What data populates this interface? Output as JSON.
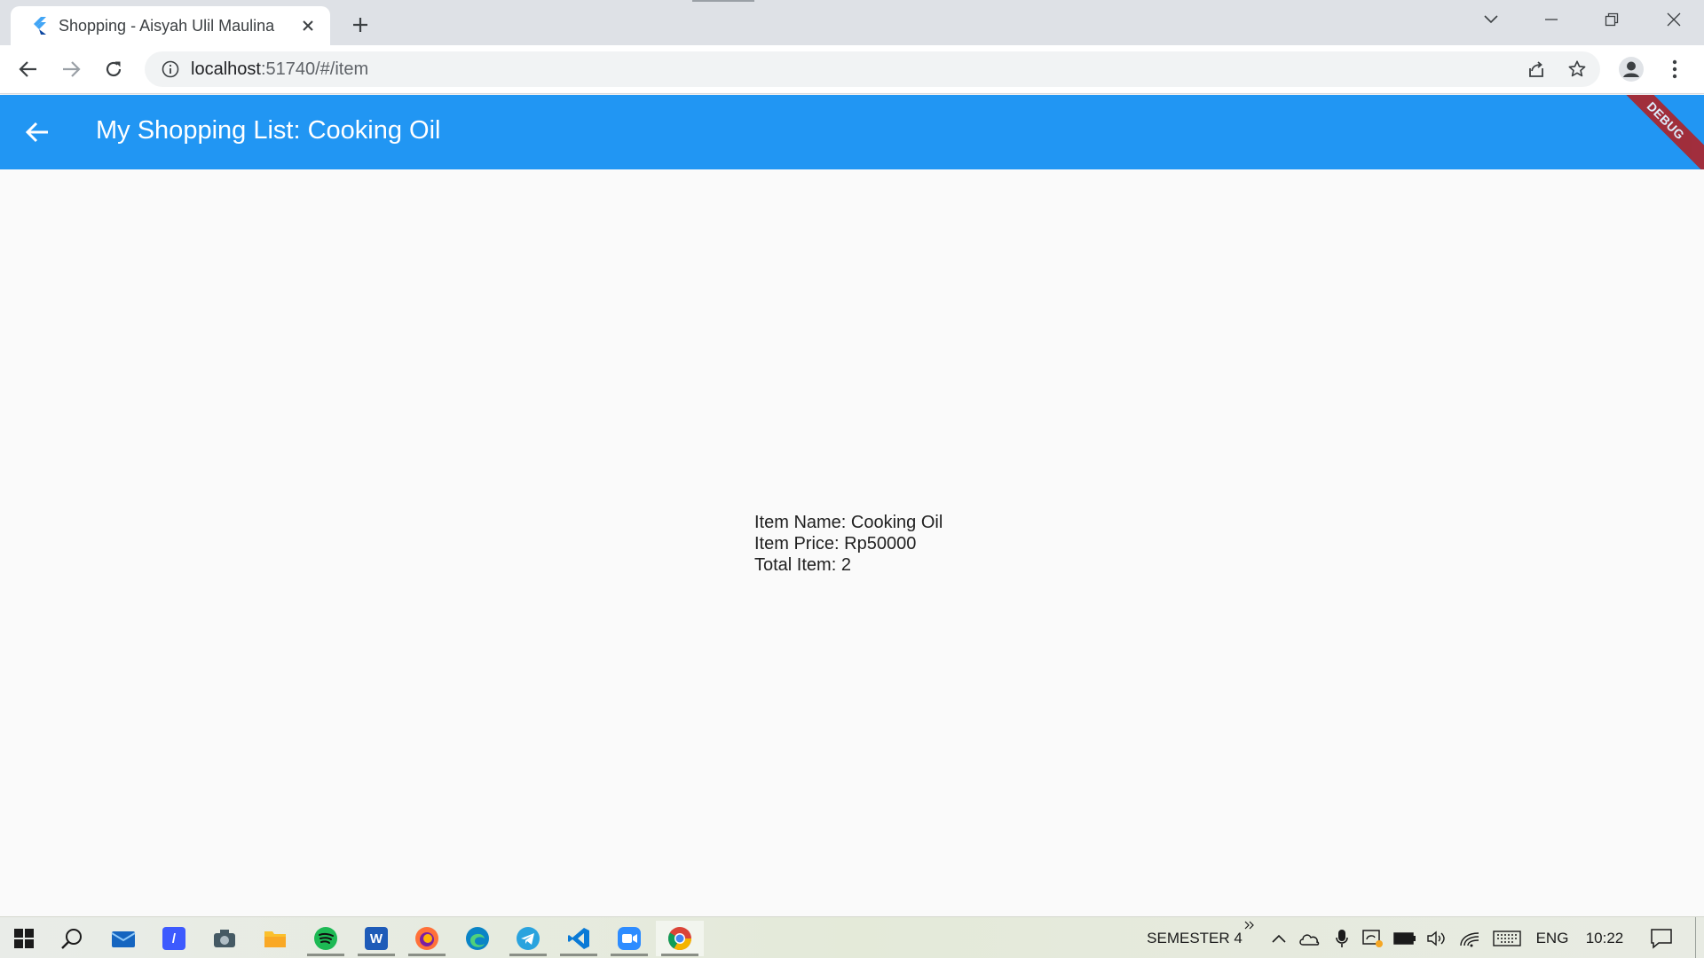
{
  "browser": {
    "tab_title": "Shopping - Aisyah Ulil Maulina",
    "url_host": "localhost",
    "url_rest": ":51740/#/item"
  },
  "app": {
    "title": "My Shopping List: Cooking Oil",
    "debug_label": "DEBUG",
    "accent_color": "#2196f3"
  },
  "item": {
    "name_line": "Item Name: Cooking Oil",
    "price_line": "Item Price: Rp50000",
    "total_line": "Total Item: 2"
  },
  "taskbar": {
    "toolbar_label": "SEMESTER 4",
    "language": "ENG",
    "clock": "10:22"
  }
}
